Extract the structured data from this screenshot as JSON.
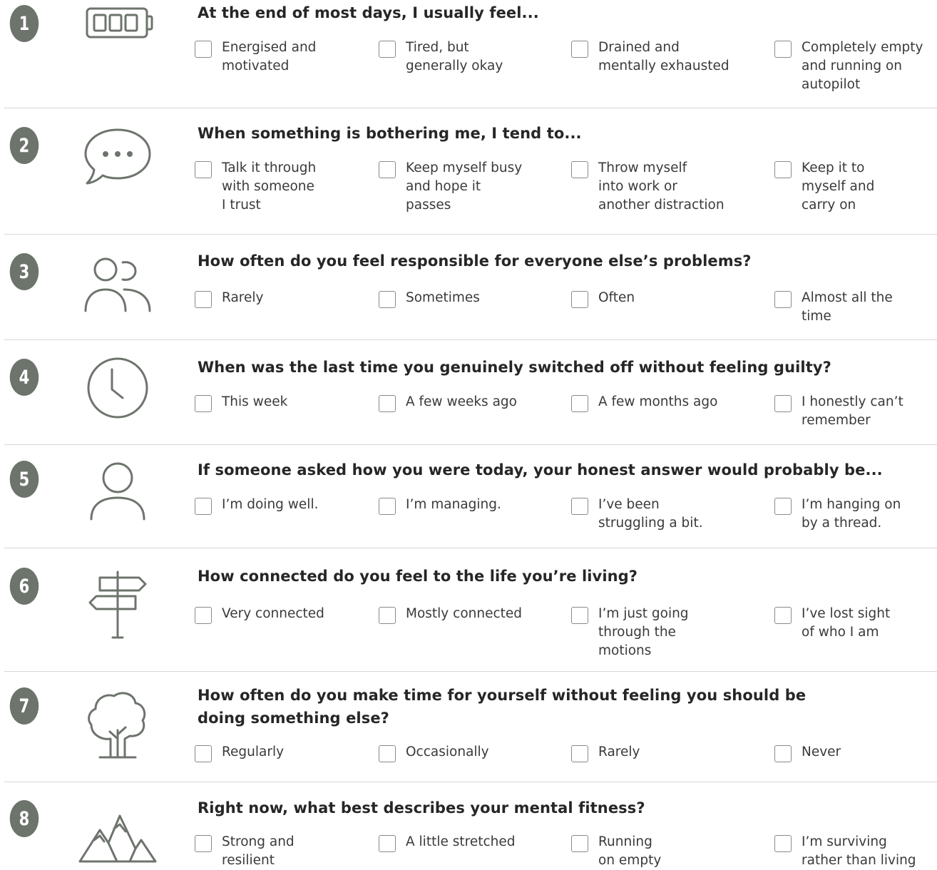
{
  "questions": [
    {
      "number": "1",
      "icon": "battery-icon",
      "title": "At the end of most days, I usually feel...",
      "options": [
        "Energised and\nmotivated",
        "Tired, but\ngenerally okay",
        "Drained and\nmentally exhausted",
        "Completely empty\nand running on\nautopilot"
      ]
    },
    {
      "number": "2",
      "icon": "speech-bubble-icon",
      "title": "When something is bothering me, I tend to...",
      "options": [
        "Talk it through\nwith someone\nI trust",
        "Keep myself busy\nand hope it\npasses",
        "Throw myself\ninto work or\nanother distraction",
        "Keep it to\nmyself and\ncarry on"
      ]
    },
    {
      "number": "3",
      "icon": "people-icon",
      "title": "How often do you feel responsible for everyone else’s problems?",
      "options": [
        "Rarely",
        "Sometimes",
        "Often",
        "Almost all the\ntime"
      ]
    },
    {
      "number": "4",
      "icon": "clock-icon",
      "title": "When was the last time you genuinely switched off without feeling guilty?",
      "options": [
        "This week",
        "A few weeks ago",
        "A few months ago",
        "I honestly can’t\nremember"
      ]
    },
    {
      "number": "5",
      "icon": "person-icon",
      "title": "If someone asked how you were today, your honest answer would probably be...",
      "options": [
        "I’m doing well.",
        "I’m managing.",
        "I’ve been\nstruggling a bit.",
        "I’m hanging on\nby a thread."
      ]
    },
    {
      "number": "6",
      "icon": "signpost-icon",
      "title": "How connected do you feel to the life you’re living?",
      "options": [
        "Very connected",
        "Mostly connected",
        "I’m just going\nthrough the\nmotions",
        "I’ve lost sight\nof who I am"
      ]
    },
    {
      "number": "7",
      "icon": "tree-icon",
      "title": "How often do you make time for yourself without feeling you should be\ndoing something else?",
      "options": [
        "Regularly",
        "Occasionally",
        "Rarely",
        "Never"
      ]
    },
    {
      "number": "8",
      "icon": "mountains-icon",
      "title": "Right now, what best describes your mental fitness?",
      "options": [
        "Strong and\nresilient",
        "A little stretched",
        "Running\non empty",
        "I’m surviving\nrather than living"
      ]
    }
  ]
}
